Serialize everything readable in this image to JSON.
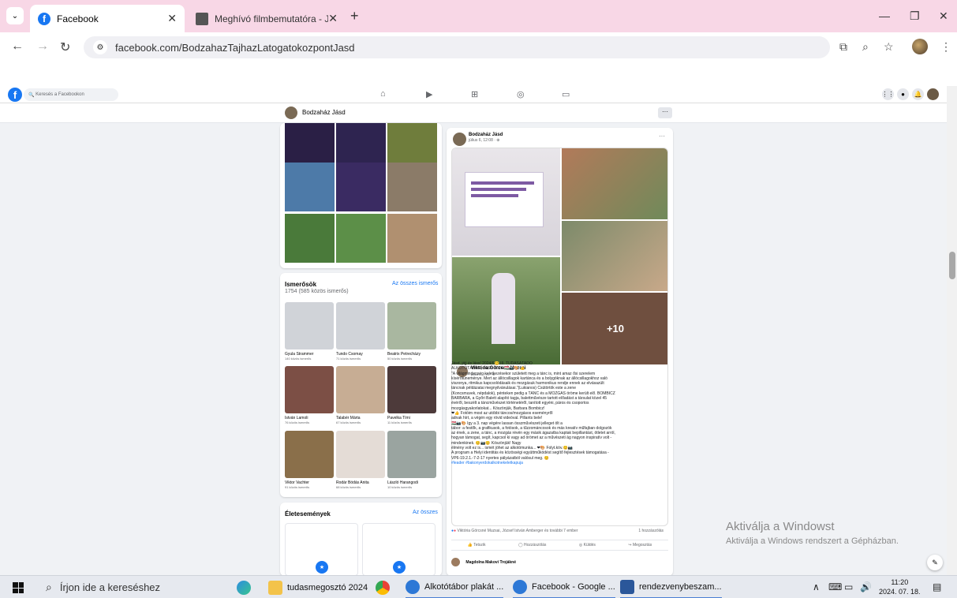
{
  "browser": {
    "tabs": [
      {
        "title": "Facebook",
        "active": true
      },
      {
        "title": "Meghívó filmbemutatóra - Jásd",
        "active": false
      }
    ],
    "url": "facebook.com/BodzahazTajhazLatogatokozpontJasd"
  },
  "fb": {
    "search_placeholder": "Keresés a Facebookon",
    "page_name": "Bodzaház Jásd",
    "more": "···"
  },
  "friends": {
    "title": "Ismerősök",
    "count": "1754 (585 közös ismerős)",
    "all_link": "Az összes ismerős",
    "items": [
      {
        "name": "Gyula Strammer",
        "mutual": "140 közös ismerős",
        "color": "#d0d3d8"
      },
      {
        "name": "Tundo Csomay",
        "mutual": "71 közös ismerős",
        "color": "#d0d3d8"
      },
      {
        "name": "Beatrix Petrecházy",
        "mutual": "50 közös ismerős",
        "color": "#a9b7a0"
      },
      {
        "name": "István Lamoli",
        "mutual": "76 közös ismerős",
        "color": "#7c4f45"
      },
      {
        "name": "Talabér Márta",
        "mutual": "67 közös ismerős",
        "color": "#c7ad94"
      },
      {
        "name": "Pavelka Tími",
        "mutual": "11 közös ismerős",
        "color": "#4d3a3a"
      },
      {
        "name": "Viktor Vachter",
        "mutual": "91 közös ismerős",
        "color": "#8a6f4a"
      },
      {
        "name": "Rodár Bódás Anita",
        "mutual": "68 közös ismerős",
        "color": "#e4dcd6"
      },
      {
        "name": "László Harangodi",
        "mutual": "10 közös ismerős",
        "color": "#9aa4a0"
      }
    ]
  },
  "life_events": {
    "title": "Életesemények",
    "all_link": "Az összes"
  },
  "post": {
    "author": "Bodzaház Jásd",
    "date": "július 6, 12:08 · ⊕",
    "plus_more": "+10",
    "shared_author": "Viktória Görcsné Muzsai",
    "shared_date": "július 6., 7:21 · ⊕",
    "text_lines": [
      "Jásd, jöjj és láss! 2024/6😊                                III. TUDÁSÁTADÓ",
      "ALKOTÓTÁBOR, JÁSD 2024                                  🇭🇺📷🎨 👍",
      "\"A világmindenség keletkezésekor született meg a tánc is, mint amaz ősi szerelem",
      "kísérőtüneménye. Mert az állócsillagok kartánca és a bolygóknak az állócsillagokhoz való",
      "viszonya, ritmikus kapcsolódásaik és mozgásuk harmonikus rendje ennek az elvásazült",
      "táncnak példázatai megnyilvánulásai.\"(Lukianos)                     Csütörtök este a zene",
      "(Koncsmuvek, népdalok), pénteken pedig  a TÁNC és a MOZGÁS öröme került elő. BOMBICZ",
      "BARBARA,  a Győri Balett alapító tagja, balettművésze tartott előadást a társulat közel 45",
      "évéről, beszélt a táncművészet történetéről, tanított egyéni, páros és csoportos",
      "mozgásgyakorlatokat...                                  Köszönjük, Barbara Bombicz!",
      "❤👍                        Fotóim  most az utóbbi táncos/mozgásos eseményről",
      "adnak hírt, a végén egy rövid videóval.                          Pillants bele!",
      "🇭🇺📷🎨                          Így a 3. nap végére lassan  összművészeti jelleget ölt a",
      "tábor: a festők, a grafikusok, a fotósok, a tűzzománcosok és más kreatív műfajban dolgozók",
      "az ének,  a zene, a tánc, a mozgás révén egy másik ágazatba kaptak bepillantást, ötletet arról,",
      "hogyan támogat, segít, kapcsol ki vagy ad örömet az a művészeti ág  nagyon inspiratív volt -",
      "mindenkinek.                        😊📷😊                          Köszönjük!  Nagy",
      "élmény volt ez is... ismét jöhet az alkotómunka... ❤🎨                        Folyt.köv.😊📷",
      "A program a Helyi identitás és közösségi együttműködést segítő fejlesztések támogatása -",
      "VP6-19.2.1.-7-2-17 nyertes pályázatból valósul meg. 😊",
      "#leader #bakonyerdokalkotnekeletkapuja"
    ],
    "reactions": "Viktória Görcsné Muzsai, József István Amberger és további 7 ember",
    "shares": "1 hozzászólás",
    "actions": [
      "Tetszik",
      "Hozzászólás",
      "Küldés",
      "Megosztás"
    ],
    "comment_author": "Magdolna Makovi Trojákné"
  },
  "watermark": {
    "line1": "Aktiválja a Windowst",
    "line2": "Aktiválja a Windows rendszert a Gépházban."
  },
  "taskbar": {
    "search": "Írjon ide a kereséshez",
    "apps": [
      {
        "label": "tudasmegosztó 2024"
      },
      {
        "label": "Alkotótábor plakát ..."
      },
      {
        "label": "Facebook - Google ..."
      },
      {
        "label": "rendezvenybeszam..."
      }
    ],
    "time": "11:20",
    "date": "2024. 07. 18."
  }
}
